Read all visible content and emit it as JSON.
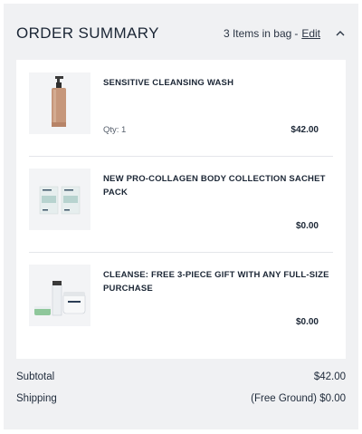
{
  "header": {
    "title": "ORDER SUMMARY",
    "bag_count_text": "3 Items in bag",
    "separator": "-",
    "edit_label": "Edit",
    "collapse_icon": "chevron-up-icon"
  },
  "items": [
    {
      "name": "SENSITIVE CLEANSING WASH",
      "qty": "Qty: 1",
      "price": "$42.00",
      "image": "pump-bottle-product-image"
    },
    {
      "name": "NEW PRO-COLLAGEN BODY COLLECTION SACHET PACK",
      "qty": "",
      "price": "$0.00",
      "image": "sachet-pack-product-image"
    },
    {
      "name": "CLEANSE: FREE 3-PIECE GIFT WITH ANY FULL-SIZE PURCHASE",
      "qty": "",
      "price": "$0.00",
      "image": "gift-set-product-image"
    }
  ],
  "totals": {
    "subtotal_label": "Subtotal",
    "subtotal_value": "$42.00",
    "shipping_label": "Shipping",
    "shipping_value": "(Free Ground) $0.00"
  },
  "colors": {
    "panel_bg": "#f0f1f3",
    "card_bg": "#ffffff",
    "text": "#1b2635"
  }
}
